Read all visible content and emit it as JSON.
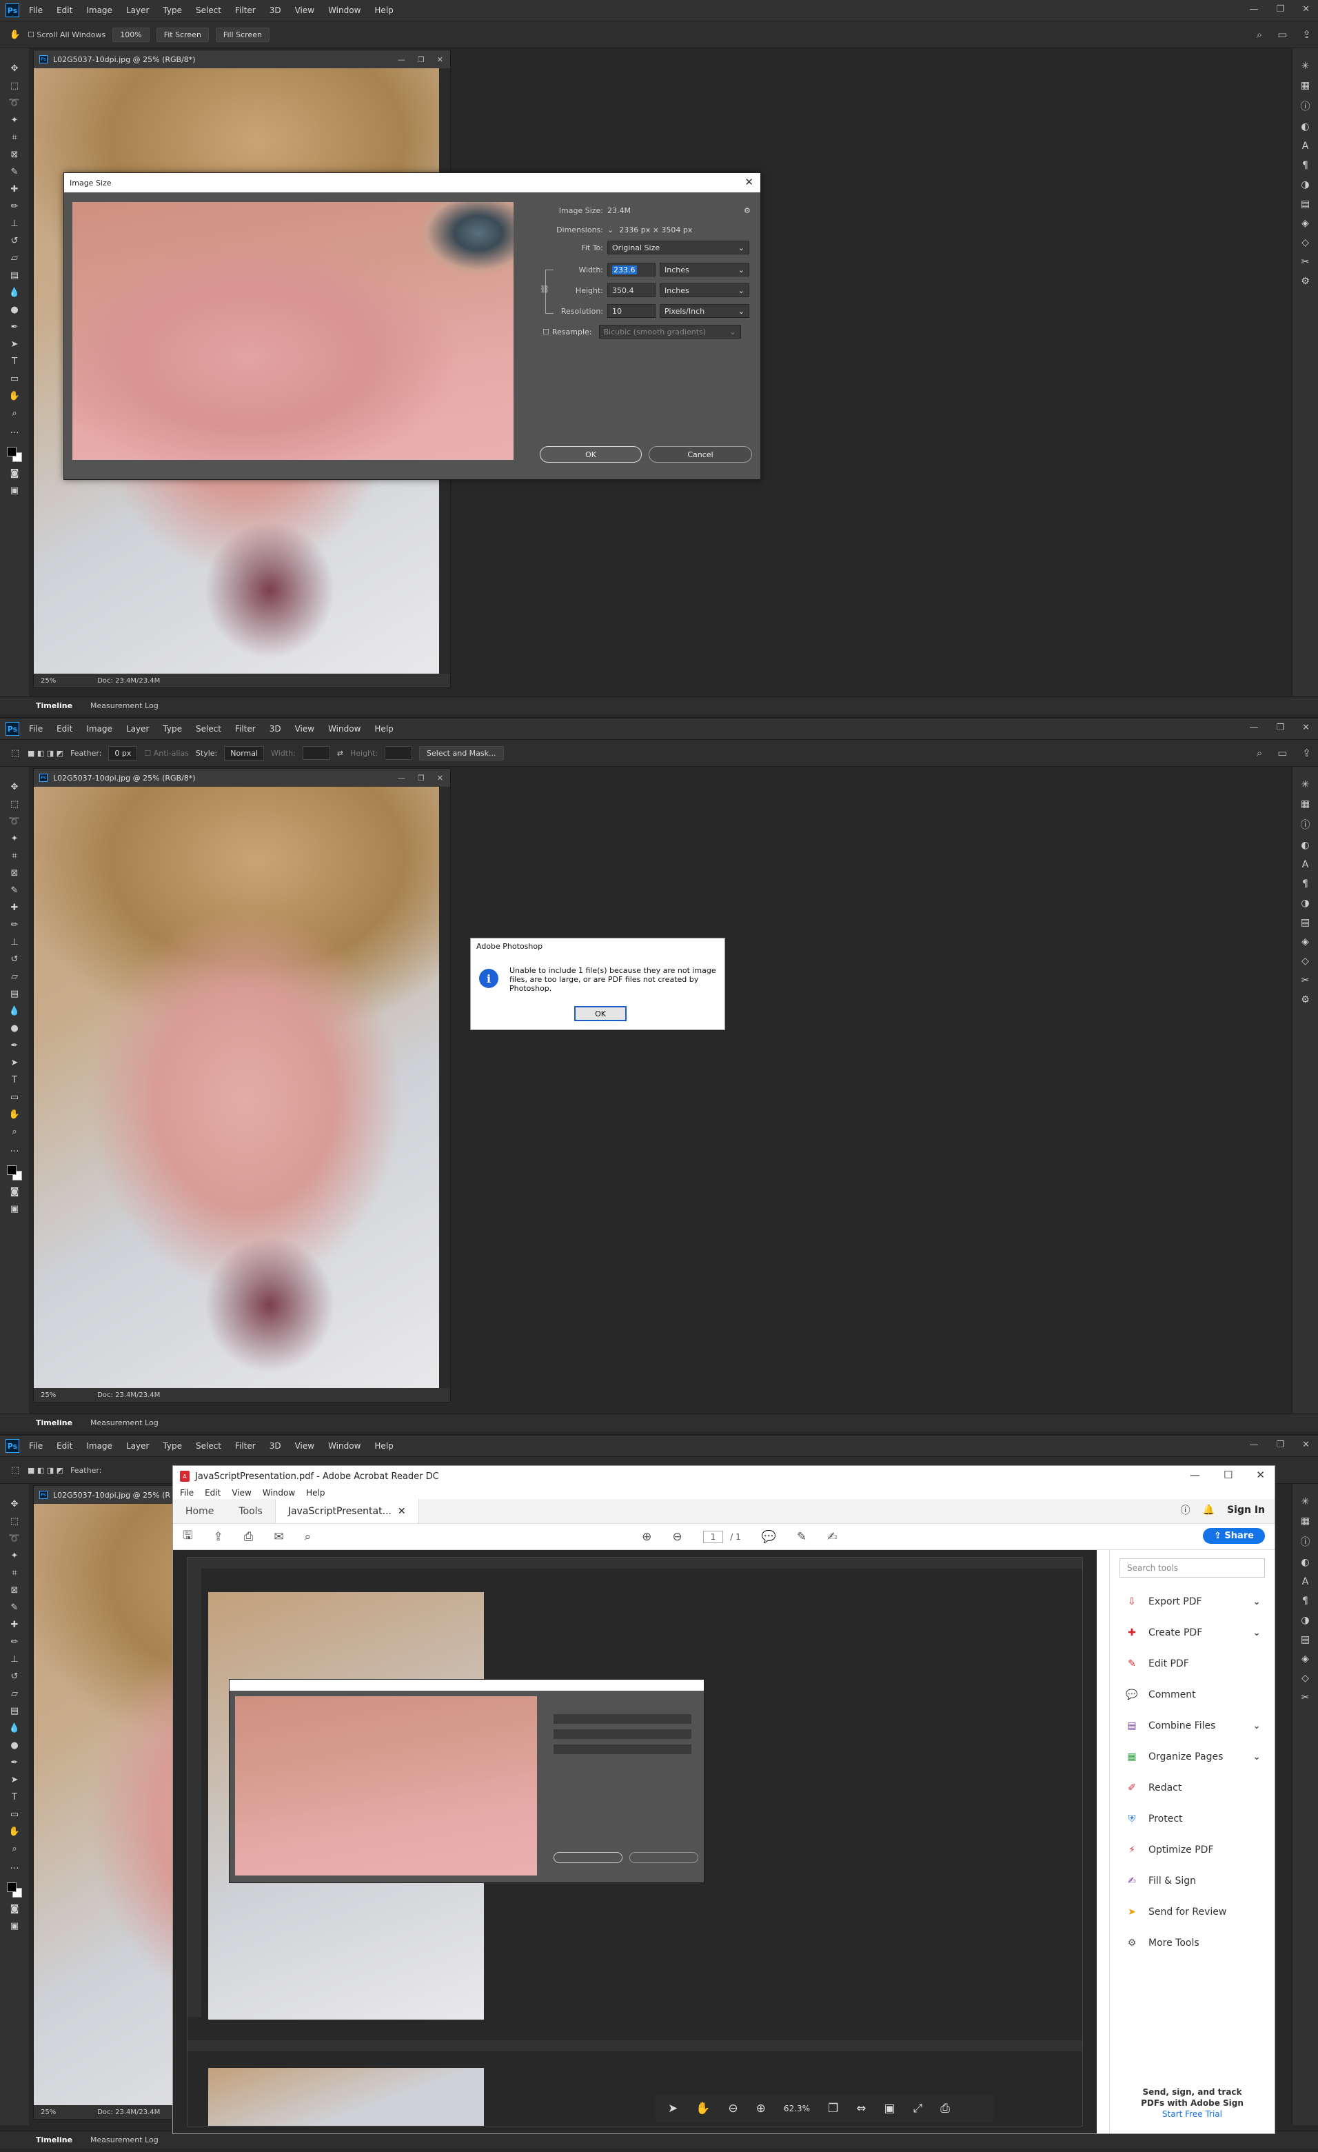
{
  "menu": {
    "items": [
      "File",
      "Edit",
      "Image",
      "Layer",
      "Type",
      "Select",
      "Filter",
      "3D",
      "View",
      "Window",
      "Help"
    ],
    "logo": "Ps"
  },
  "panel1": {
    "options": {
      "scroll_all": "Scroll All Windows",
      "zoom": "100%",
      "fit_screen": "Fit Screen",
      "fill_screen": "Fill Screen"
    },
    "doc": {
      "title": "L02G5037-10dpi.jpg @ 25% (RGB/8*)",
      "zoom": "25%",
      "doc_info": "Doc: 23.4M/23.4M"
    },
    "dialog": {
      "title": "Image Size",
      "image_size_label": "Image Size:",
      "image_size_value": "23.4M",
      "dimensions_label": "Dimensions:",
      "dimensions_value": "2336 px  ×  3504 px",
      "fit_to_label": "Fit To:",
      "fit_to_value": "Original Size",
      "width_label": "Width:",
      "width_value": "233.6",
      "width_unit": "Inches",
      "height_label": "Height:",
      "height_value": "350.4",
      "height_unit": "Inches",
      "resolution_label": "Resolution:",
      "resolution_value": "10",
      "resolution_unit": "Pixels/Inch",
      "resample_label": "Resample:",
      "resample_value": "Bicubic (smooth gradients)",
      "ok": "OK",
      "cancel": "Cancel"
    },
    "bottom_tabs": [
      "Timeline",
      "Measurement Log"
    ]
  },
  "panel2": {
    "options": {
      "feather_label": "Feather:",
      "feather_value": "0 px",
      "anti_alias": "Anti-alias",
      "style_label": "Style:",
      "style_value": "Normal",
      "width_label": "Width:",
      "height_label": "Height:",
      "select_mask": "Select and Mask..."
    },
    "doc": {
      "title": "L02G5037-10dpi.jpg @ 25% (RGB/8*)",
      "zoom": "25%",
      "doc_info": "Doc: 23.4M/23.4M"
    },
    "alert": {
      "title": "Adobe Photoshop",
      "message": "Unable to include 1 file(s) because they are not image files, are too large, or are PDF files not created by Photoshop.",
      "ok": "OK"
    },
    "bottom_tabs": [
      "Timeline",
      "Measurement Log"
    ]
  },
  "panel3": {
    "options": {
      "feather_label": "Feather:"
    },
    "doc": {
      "title": "L02G5037-10dpi.jpg @ 25% (R",
      "zoom": "25%",
      "doc_info": "Doc: 23.4M/23.4M"
    },
    "bottom_tabs": [
      "Timeline",
      "Measurement Log"
    ],
    "acrobat": {
      "window_title": "JavaScriptPresentation.pdf - Adobe Acrobat Reader DC",
      "menu": [
        "File",
        "Edit",
        "View",
        "Window",
        "Help"
      ],
      "tabs": [
        "Home",
        "Tools"
      ],
      "doc_tab": "JavaScriptPresentat...",
      "sign_in": "Sign In",
      "share": "Share",
      "page_current": "1",
      "page_total": "/  1",
      "search_placeholder": "Search tools",
      "tools": [
        {
          "label": "Export PDF",
          "icon": "export-pdf-icon",
          "color": "#d7282f",
          "chevron": true
        },
        {
          "label": "Create PDF",
          "icon": "create-pdf-icon",
          "color": "#d7282f",
          "chevron": true
        },
        {
          "label": "Edit PDF",
          "icon": "edit-pdf-icon",
          "color": "#d7282f",
          "chevron": false
        },
        {
          "label": "Comment",
          "icon": "comment-icon",
          "color": "#e8a200",
          "chevron": false
        },
        {
          "label": "Combine Files",
          "icon": "combine-files-icon",
          "color": "#7b3fa0",
          "chevron": true
        },
        {
          "label": "Organize Pages",
          "icon": "organize-pages-icon",
          "color": "#2f9e44",
          "chevron": true
        },
        {
          "label": "Redact",
          "icon": "redact-icon",
          "color": "#d7282f",
          "chevron": false
        },
        {
          "label": "Protect",
          "icon": "protect-icon",
          "color": "#1473e6",
          "chevron": false
        },
        {
          "label": "Optimize PDF",
          "icon": "optimize-pdf-icon",
          "color": "#d7282f",
          "chevron": false
        },
        {
          "label": "Fill & Sign",
          "icon": "fill-sign-icon",
          "color": "#7b3fa0",
          "chevron": false
        },
        {
          "label": "Send for Review",
          "icon": "send-review-icon",
          "color": "#e8a200",
          "chevron": false
        },
        {
          "label": "More Tools",
          "icon": "more-tools-icon",
          "color": "#555555",
          "chevron": false
        }
      ],
      "promo_line1": "Send, sign, and track",
      "promo_line2": "PDFs with Adobe Sign",
      "promo_link": "Start Free Trial",
      "zoom": "62.3%"
    }
  }
}
